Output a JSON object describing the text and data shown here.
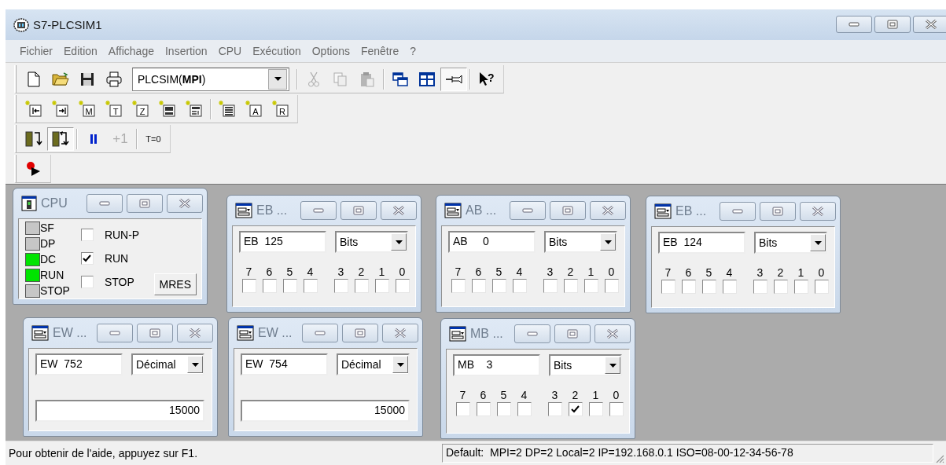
{
  "window": {
    "title": "S7-PLCSIM1"
  },
  "menu": [
    "Fichier",
    "Edition",
    "Affichage",
    "Insertion",
    "CPU",
    "Exécution",
    "Options",
    "Fenêtre",
    "?"
  ],
  "toolbars": [
    [
      {
        "kind": "new",
        "disabled": false,
        "pressed": false
      },
      {
        "kind": "open",
        "disabled": false,
        "pressed": false
      },
      {
        "kind": "save",
        "disabled": false,
        "pressed": false
      },
      {
        "kind": "print",
        "disabled": false,
        "pressed": false
      },
      {
        "kind": "combo",
        "value": "PLCSIM(**MPI**)"
      },
      {
        "kind": "separator"
      },
      {
        "kind": "cut",
        "disabled": true,
        "pressed": false
      },
      {
        "kind": "copy",
        "disabled": true,
        "pressed": false
      },
      {
        "kind": "paste",
        "disabled": true,
        "pressed": false
      },
      {
        "kind": "separator"
      },
      {
        "kind": "cascade",
        "disabled": false,
        "pressed": false
      },
      {
        "kind": "tile",
        "disabled": false,
        "pressed": false
      },
      {
        "kind": "pin",
        "disabled": false,
        "pressed": true
      },
      {
        "kind": "separator"
      },
      {
        "kind": "help",
        "label": "?",
        "disabled": false,
        "pressed": false
      }
    ],
    [
      {
        "kind": "in"
      },
      {
        "kind": "out"
      },
      {
        "kind": "letter",
        "label": "M"
      },
      {
        "kind": "letter",
        "label": "T"
      },
      {
        "kind": "letter",
        "label": "Z"
      },
      {
        "kind": "var"
      },
      {
        "kind": "vert"
      },
      {
        "kind": "separator"
      },
      {
        "kind": "stack"
      },
      {
        "kind": "letter",
        "label": "A"
      },
      {
        "kind": "letter",
        "label": "R"
      }
    ],
    [
      {
        "kind": "single",
        "disabled": false,
        "pressed": false
      },
      {
        "kind": "continuous",
        "disabled": false,
        "pressed": true
      },
      {
        "kind": "separator"
      },
      {
        "kind": "pause",
        "disabled": false,
        "pressed": false
      },
      {
        "kind": "step",
        "label": "+1",
        "disabled": true,
        "pressed": false
      },
      {
        "kind": "separator"
      },
      {
        "kind": "reset",
        "label": "T=0",
        "disabled": false,
        "pressed": false
      }
    ],
    [
      {
        "kind": "record"
      }
    ]
  ],
  "windows": [
    {
      "kind": "cpu",
      "title": "CPU",
      "leds": [
        {
          "label": "SF",
          "on": false
        },
        {
          "label": "DP",
          "on": false
        },
        {
          "label": "DC",
          "on": true
        },
        {
          "label": "RUN",
          "on": true
        },
        {
          "label": "STOP",
          "on": false
        }
      ],
      "modes": [
        {
          "label": "RUN-P",
          "checked": false
        },
        {
          "label": "RUN",
          "checked": true
        },
        {
          "label": "STOP",
          "checked": false
        }
      ],
      "button": "MRES"
    },
    {
      "kind": "bits",
      "title": "EB ...",
      "address": "EB  125",
      "format": "Bits",
      "bits": [
        {
          "label": "7",
          "checked": false
        },
        {
          "label": "6",
          "checked": false
        },
        {
          "label": "5",
          "checked": false
        },
        {
          "label": "4",
          "checked": false
        },
        {
          "label": "3",
          "checked": false
        },
        {
          "label": "2",
          "checked": false
        },
        {
          "label": "1",
          "checked": false
        },
        {
          "label": "0",
          "checked": false
        }
      ]
    },
    {
      "kind": "bits",
      "title": "AB ...",
      "address": "AB     0",
      "format": "Bits",
      "bits": [
        {
          "label": "7",
          "checked": false
        },
        {
          "label": "6",
          "checked": false
        },
        {
          "label": "5",
          "checked": false
        },
        {
          "label": "4",
          "checked": false
        },
        {
          "label": "3",
          "checked": false
        },
        {
          "label": "2",
          "checked": false
        },
        {
          "label": "1",
          "checked": false
        },
        {
          "label": "0",
          "checked": false
        }
      ]
    },
    {
      "kind": "bits",
      "title": "EB ...",
      "address": "EB  124",
      "format": "Bits",
      "bits": [
        {
          "label": "7",
          "checked": false
        },
        {
          "label": "6",
          "checked": false
        },
        {
          "label": "5",
          "checked": false
        },
        {
          "label": "4",
          "checked": false
        },
        {
          "label": "3",
          "checked": false
        },
        {
          "label": "2",
          "checked": false
        },
        {
          "label": "1",
          "checked": false
        },
        {
          "label": "0",
          "checked": false
        }
      ]
    },
    {
      "kind": "decimal",
      "title": "EW ...",
      "address": "EW  752",
      "format": "Décimal",
      "value": "15000"
    },
    {
      "kind": "decimal",
      "title": "EW ...",
      "address": "EW  754",
      "format": "Décimal",
      "value": "15000"
    },
    {
      "kind": "bits",
      "title": "MB ...",
      "address": "MB    3",
      "format": "Bits",
      "bits": [
        {
          "label": "7",
          "checked": false
        },
        {
          "label": "6",
          "checked": false
        },
        {
          "label": "5",
          "checked": false
        },
        {
          "label": "4",
          "checked": false
        },
        {
          "label": "3",
          "checked": false
        },
        {
          "label": "2",
          "checked": true
        },
        {
          "label": "1",
          "checked": false
        },
        {
          "label": "0",
          "checked": false
        }
      ]
    }
  ],
  "status_bar": {
    "help": "Pour obtenir de l'aide, appuyez sur F1.",
    "connection": "Default:  MPI=2 DP=2 Local=2 IP=192.168.0.1 ISO=08-00-12-34-56-78"
  }
}
